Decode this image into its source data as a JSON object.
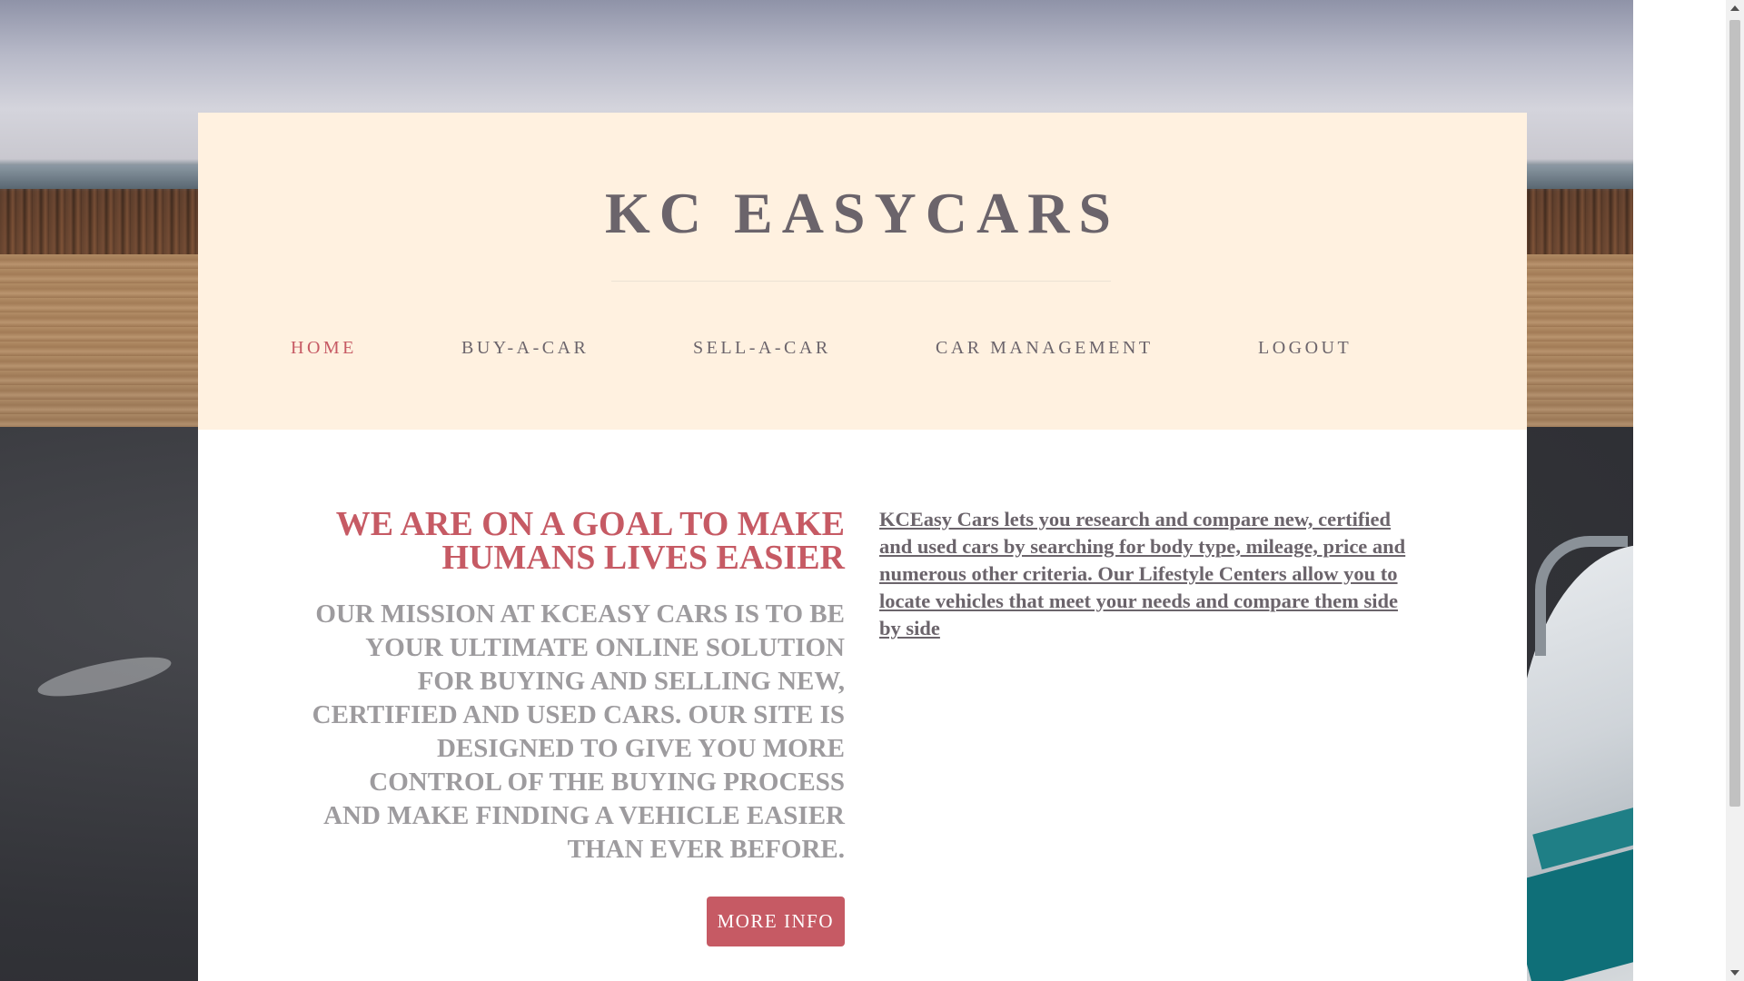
{
  "brand": {
    "title": "KC EASYCARS"
  },
  "nav": {
    "items": [
      {
        "label": "HOME",
        "active": true
      },
      {
        "label": "BUY-A-CAR",
        "active": false
      },
      {
        "label": "SELL-A-CAR",
        "active": false
      },
      {
        "label": "CAR MANAGEMENT",
        "active": false
      },
      {
        "label": "LOGOUT",
        "active": false
      }
    ]
  },
  "main": {
    "headline": "WE ARE ON A GOAL TO MAKE HUMANS LIVES EASIER",
    "mission": "OUR MISSION AT KCEASY CARS IS TO BE YOUR ULTIMATE ONLINE SOLUTION FOR BUYING AND SELLING NEW, CERTIFIED AND USED CARS. OUR SITE IS DESIGNED TO GIVE YOU MORE CONTROL OF THE BUYING PROCESS AND MAKE FINDING A VEHICLE EASIER THAN EVER BEFORE.",
    "more_info_label": "MORE INFO",
    "description_link": "KCEasy Cars lets you research and compare new, certified and used cars by searching for body type, mileage, price and numerous other criteria. Our Lifestyle Centers allow you to locate vehicles that meet your needs and compare them side by side"
  },
  "colors": {
    "accent": "#c65a64",
    "text": "#6b646b",
    "muted": "#9d9b9e",
    "header_bg": "#fff1e0"
  }
}
